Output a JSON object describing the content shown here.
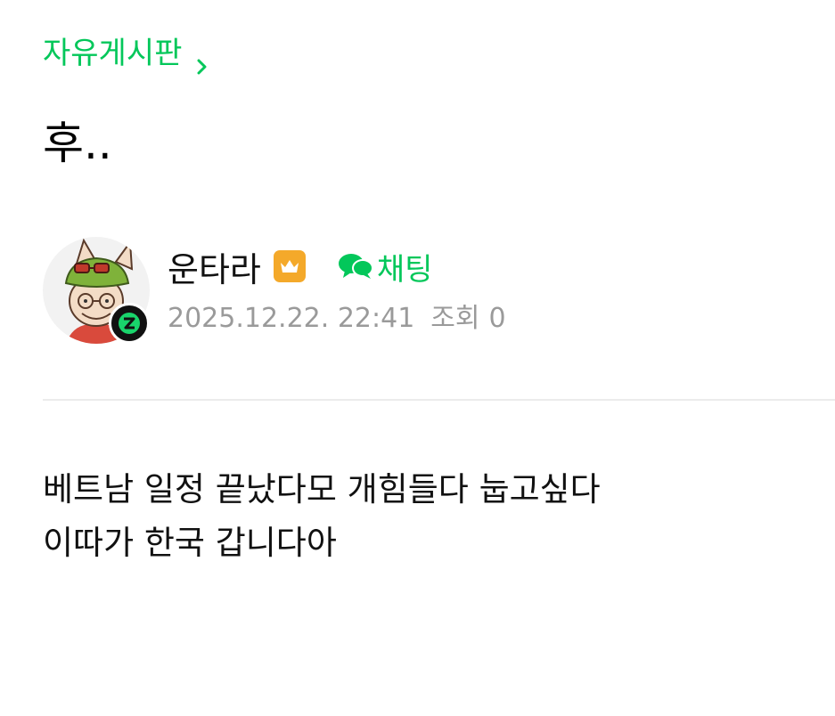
{
  "board": {
    "name": "자유게시판",
    "chevron_icon": "chevron-right-icon",
    "color": "#03c75a"
  },
  "post": {
    "title": "후..",
    "body_lines": [
      "베트남 일정 끝났다모 개힘들다 눕고싶다",
      "이따가 한국 갑니다아"
    ]
  },
  "author": {
    "nickname": "운타라",
    "avatar_icon": "avatar-teemo-icon",
    "level_badge_icon": "level-badge-icon",
    "rank_badge_icon": "crown-badge-icon",
    "rank_badge_color": "#f4a92a",
    "chat_label": "채팅",
    "chat_icon": "chat-bubble-icon"
  },
  "meta": {
    "datetime": "2025.12.22. 22:41",
    "views_label": "조회",
    "views_count": "0"
  }
}
